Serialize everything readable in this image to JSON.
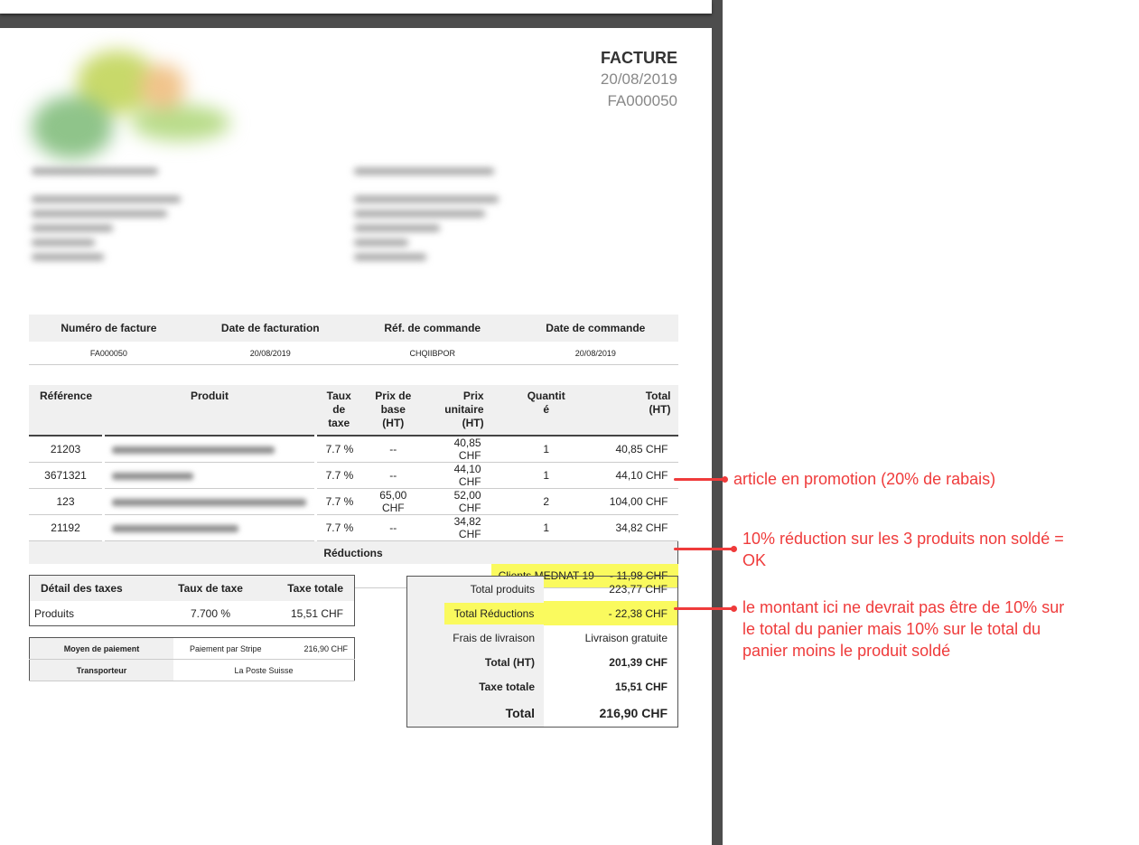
{
  "header": {
    "title": "FACTURE",
    "date": "20/08/2019",
    "number": "FA000050"
  },
  "info_table": {
    "headers": [
      "Numéro de facture",
      "Date de facturation",
      "Réf. de commande",
      "Date de commande"
    ],
    "values": [
      "FA000050",
      "20/08/2019",
      "CHQIIBPOR",
      "20/08/2019"
    ]
  },
  "products_table": {
    "headers": {
      "ref": "Référence",
      "product": "Produit",
      "tax_rate_1": "Taux de",
      "tax_rate_2": "taxe",
      "base_price_1": "Prix de base",
      "base_price_2": "(HT)",
      "unit_price_1": "Prix unitaire",
      "unit_price_2": "(HT)",
      "qty_1": "Quantit",
      "qty_2": "é",
      "total_1": "Total",
      "total_2": "(HT)"
    },
    "rows": [
      {
        "ref": "21203",
        "tax": "7.7 %",
        "base": "--",
        "unit": "40,85 CHF",
        "qty": "1",
        "total": "40,85 CHF"
      },
      {
        "ref": "3671321",
        "tax": "7.7 %",
        "base": "--",
        "unit": "44,10 CHF",
        "qty": "1",
        "total": "44,10 CHF"
      },
      {
        "ref": "123",
        "tax": "7.7 %",
        "base": "65,00 CHF",
        "unit": "52,00 CHF",
        "qty": "2",
        "total": "104,00 CHF"
      },
      {
        "ref": "21192",
        "tax": "7.7 %",
        "base": "--",
        "unit": "34,82 CHF",
        "qty": "1",
        "total": "34,82 CHF"
      }
    ],
    "reductions_label": "Réductions",
    "reduction": {
      "name": "Clients MEDNAT 19",
      "amount": "- 11,98 CHF"
    }
  },
  "tax_table": {
    "headers": [
      "Détail des taxes",
      "Taux de taxe",
      "Taxe totale"
    ],
    "row": [
      "Produits",
      "7.700 %",
      "15,51 CHF"
    ]
  },
  "payment_table": {
    "payment_label": "Moyen de paiement",
    "payment_method": "Paiement par Stripe",
    "payment_amount": "216,90 CHF",
    "carrier_label": "Transporteur",
    "carrier": "La Poste Suisse"
  },
  "totals": {
    "products_label": "Total produits",
    "products": "223,77 CHF",
    "reductions_label": "Total Réductions",
    "reductions": "- 22,38 CHF",
    "shipping_label": "Frais de livraison",
    "shipping": "Livraison gratuite",
    "total_ht_label": "Total (HT)",
    "total_ht": "201,39 CHF",
    "tax_label": "Taxe totale",
    "tax": "15,51 CHF",
    "total_label": "Total",
    "total": "216,90 CHF"
  },
  "annotations": {
    "promo": "article en promotion (20% de rabais)",
    "reduction_ok_1": "10% réduction sur les 3 produits non soldé =",
    "reduction_ok_2": "OK",
    "total_issue_1": "le montant ici ne devrait pas être de 10% sur",
    "total_issue_2": "le total du panier mais 10% sur le total du",
    "total_issue_3": "panier moins le produit soldé"
  },
  "colors": {
    "highlight": "#fafa5e",
    "annotation": "#ef3b3b",
    "header_bg": "#f0f0f0"
  }
}
